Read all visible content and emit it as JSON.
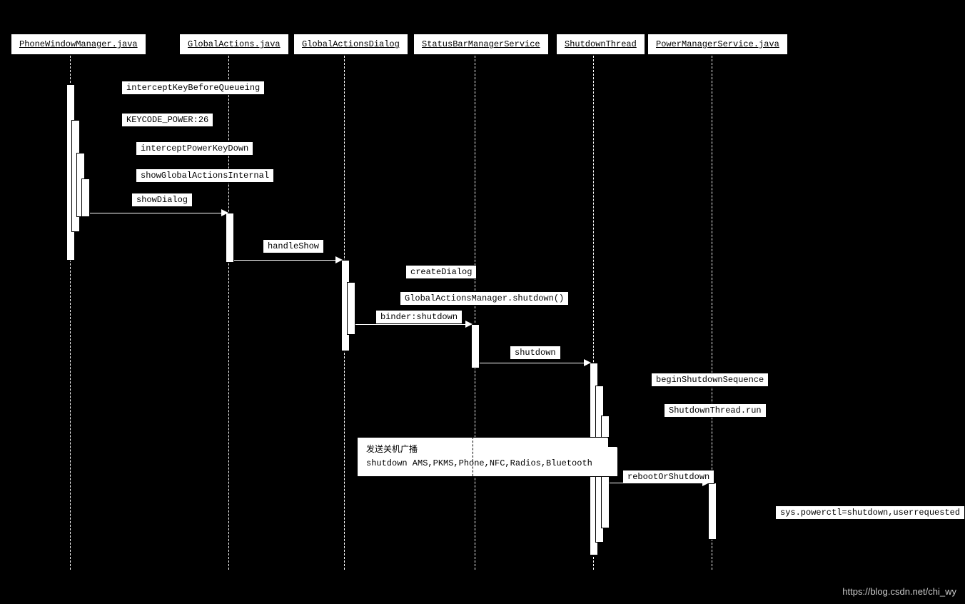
{
  "participants": {
    "p1": "PhoneWindowManager.java",
    "p2": "GlobalActions.java",
    "p3": "GlobalActionsDialog",
    "p4": "StatusBarManagerService",
    "p5": "ShutdownThread",
    "p6": "PowerManagerService.java"
  },
  "messages": {
    "m1": "interceptKeyBeforeQueueing",
    "m2": "KEYCODE_POWER:26",
    "m3": "interceptPowerKeyDown",
    "m4": "showGlobalActionsInternal",
    "m5": "showDialog",
    "m6": "handleShow",
    "m7": "createDialog",
    "m8": "GlobalActionsManager.shutdown()",
    "m9": "binder:shutdown",
    "m10": "shutdown",
    "m11": "beginShutdownSequence",
    "m12": "ShutdownThread.run",
    "m13": "rebootOrShutdown",
    "m14": "sys.powerctl=shutdown,userrequested"
  },
  "note": {
    "line1": "发送关机广播",
    "line2": "shutdown AMS,PKMS,Phone,NFC,Radios,Bluetooth"
  },
  "watermark": "https://blog.csdn.net/chi_wy"
}
